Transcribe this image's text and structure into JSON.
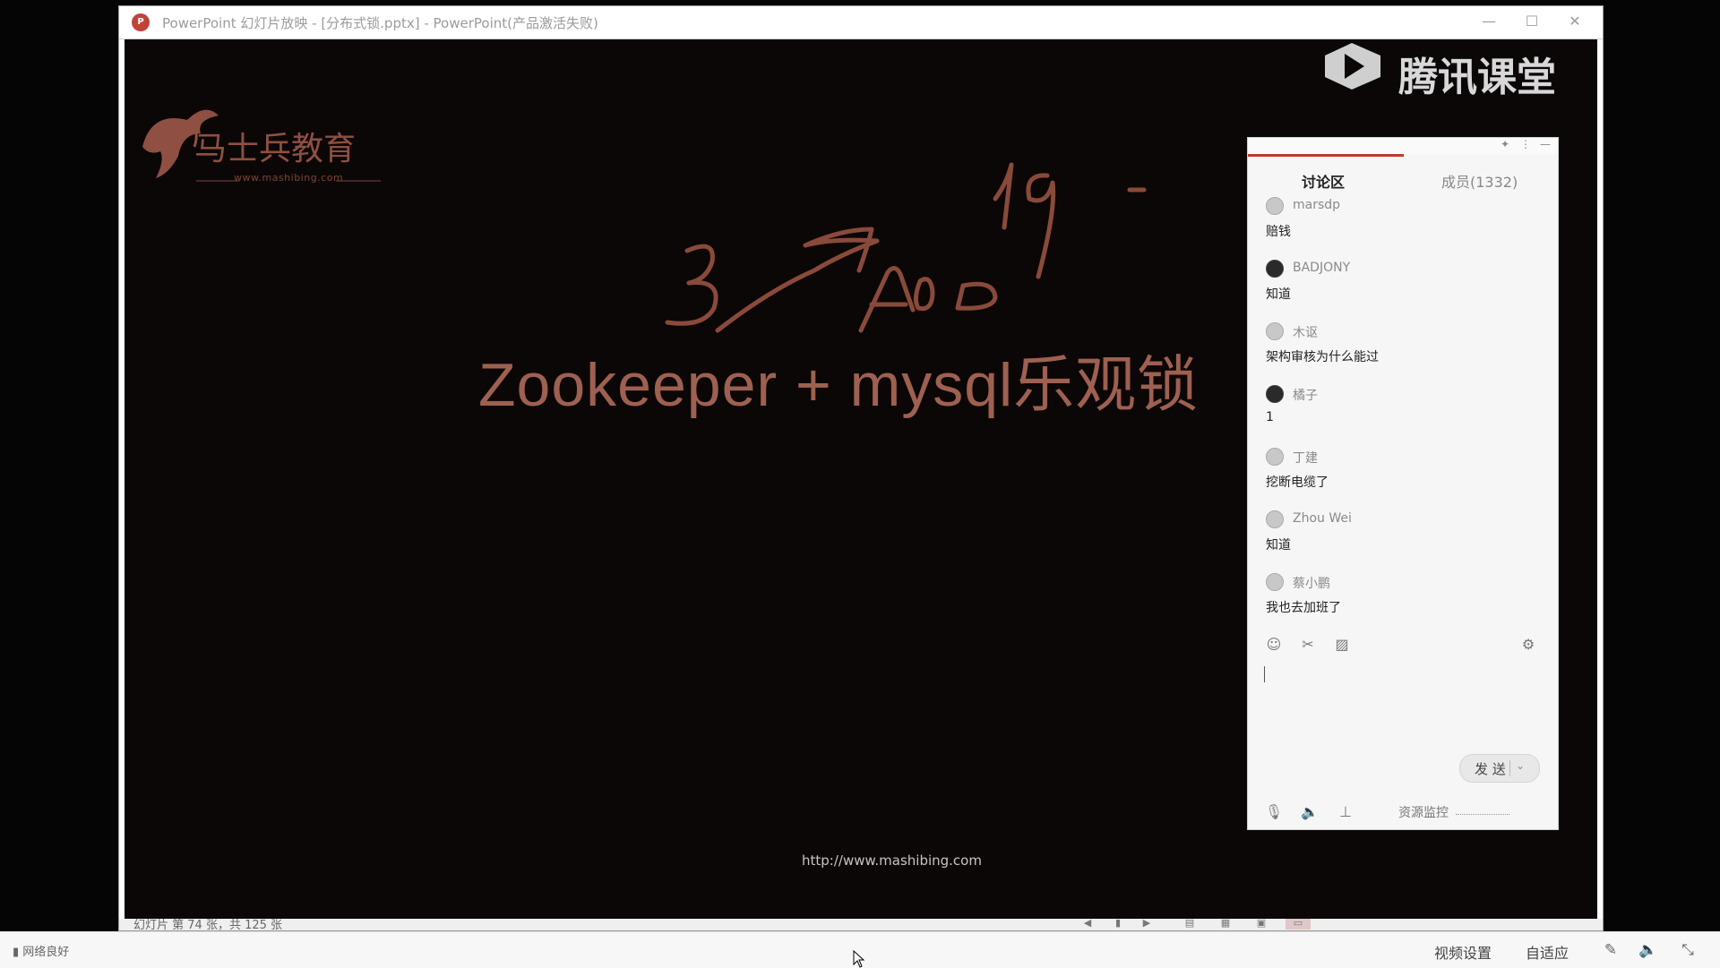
{
  "window": {
    "title": "PowerPoint 幻灯片放映 - [分布式锁.pptx] - PowerPoint(产品激活失败)",
    "logo_text": "P"
  },
  "slide": {
    "title": "Zookeeper + mysql乐观锁",
    "url": "http://www.mashibing.com",
    "brand": {
      "name": "马士兵教育",
      "url": "www.mashibing.com"
    },
    "overlay_logo": "腾讯课堂",
    "annotation_text": "3 → A0 19"
  },
  "status_bar": {
    "slide_counter": "幻灯片 第 74 张，共 125 张"
  },
  "chat": {
    "tabs": {
      "discussion": "讨论区",
      "members": "成员(1332)"
    },
    "messages": [
      {
        "user": "marsdp",
        "text": "赔钱",
        "avatar": "default"
      },
      {
        "user": "BADJONY",
        "text": "知道",
        "avatar": "photo"
      },
      {
        "user": "木讴",
        "text": "架构审核为什么能过",
        "avatar": "default"
      },
      {
        "user": "橘子",
        "text": "1",
        "avatar": "photo"
      },
      {
        "user": "丁建",
        "text": "挖断电缆了",
        "avatar": "default"
      },
      {
        "user": "Zhou Wei",
        "text": "知道",
        "avatar": "default"
      },
      {
        "user": "蔡小鹏",
        "text": "我也去加班了",
        "avatar": "default"
      }
    ],
    "send_label": "发 送",
    "resource_monitor": "资源监控"
  },
  "bottom_bar": {
    "network": "网络良好",
    "video_settings": "视频设置",
    "fit": "自适应"
  },
  "colors": {
    "slide_bg": "#0c0707",
    "slide_title": "#9e6050",
    "annotation": "#8a4a3a",
    "chat_tab_accent": "#c0392b"
  }
}
